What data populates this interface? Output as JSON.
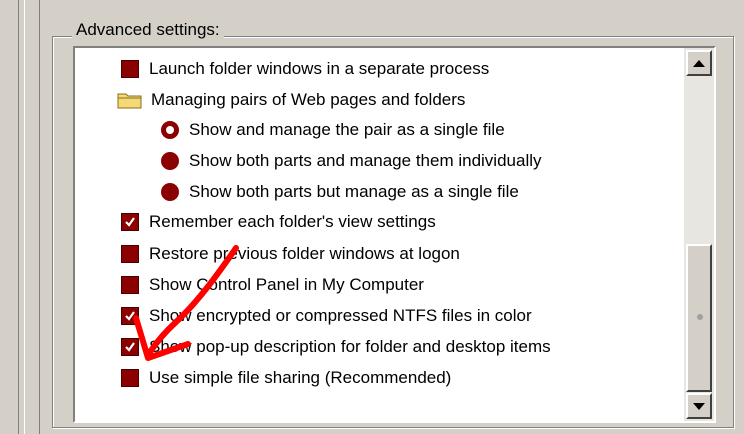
{
  "group": {
    "label": "Advanced settings:"
  },
  "items": [
    {
      "kind": "checkbox",
      "checked": false,
      "label": "Launch folder windows in a separate process"
    },
    {
      "kind": "folder",
      "icon": "folder-icon",
      "label": "Managing pairs of Web pages and folders"
    },
    {
      "kind": "radio",
      "selected": true,
      "label": "Show and manage the pair as a single file"
    },
    {
      "kind": "radio",
      "selected": false,
      "label": "Show both parts and manage them individually"
    },
    {
      "kind": "radio",
      "selected": false,
      "label": "Show both parts but manage as a single file"
    },
    {
      "kind": "checkbox",
      "checked": true,
      "label": "Remember each folder's view settings"
    },
    {
      "kind": "checkbox",
      "checked": false,
      "label": "Restore previous folder windows at logon"
    },
    {
      "kind": "checkbox",
      "checked": false,
      "label": "Show Control Panel in My Computer"
    },
    {
      "kind": "checkbox",
      "checked": true,
      "label": "Show encrypted or compressed NTFS files in color"
    },
    {
      "kind": "checkbox",
      "checked": true,
      "label": "Show pop-up description for folder and desktop items"
    },
    {
      "kind": "checkbox",
      "checked": false,
      "label": "Use simple file sharing (Recommended)"
    }
  ],
  "colors": {
    "control": "#8b0000",
    "annotation_arrow": "#ff0000",
    "face": "#d4d0c8"
  },
  "annotation": {
    "type": "red-arrow",
    "points_to_item": "Use simple file sharing (Recommended)"
  }
}
